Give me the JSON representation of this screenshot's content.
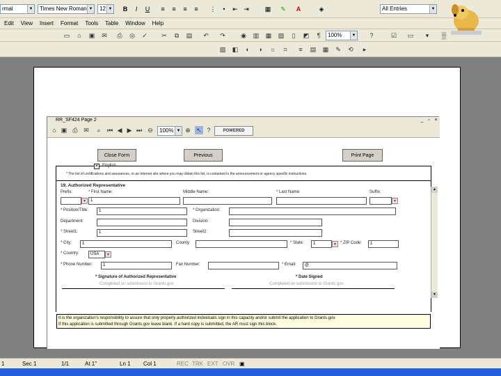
{
  "format_toolbar": {
    "style_value": "rmal",
    "font_value": "Times New Roman",
    "size_value": "12",
    "bold": "B",
    "italic": "I",
    "underline": "U",
    "view_combo": "All Entries"
  },
  "menu": {
    "items": [
      "Edit",
      "View",
      "Insert",
      "Format",
      "Tools",
      "Table",
      "Window",
      "Help"
    ]
  },
  "std_toolbar": {
    "zoom": "100%"
  },
  "form_window": {
    "title": "RR_SF424 Page 2",
    "zoom": "100%",
    "powered_label": "POWERED",
    "buttons": {
      "close_form": "Close Form",
      "previous": "Previous",
      "print_page": "Print Page"
    },
    "english_item": "English",
    "note_text": "* The list of certifications and assurances, or an Internet site where you may obtain this list, is contained in the announcement or agency specific instructions.",
    "section_title": "19. Authorized Representative",
    "labels": {
      "prefix": "Prefix:",
      "first_name": "* First Name:",
      "middle_name": "Middle Name:",
      "last_name": "* Last Name:",
      "suffix": "Suffix:",
      "position": "* Position/Title:",
      "organization": "* Organization:",
      "department": "Department:",
      "division": "Division:",
      "street1": "* Street1:",
      "street2": "Street2:",
      "city": "* City:",
      "county": "County:",
      "state": "* State:",
      "zip": "* ZIP Code:",
      "country": "* Country:",
      "phone": "* Phone Number:",
      "fax": "Fax Number:",
      "email": "* Email:"
    },
    "values": {
      "first_name": "1",
      "position": "1",
      "street1": "1",
      "city": "1",
      "state": "1",
      "zip": "1",
      "country": "USA",
      "phone": "1",
      "email": "@"
    },
    "signature": {
      "sig_title": "* Signature of Authorized Representative",
      "sig_value": "Completed on submission to Grants.gov",
      "date_title": "* Date Signed",
      "date_value": "Completed on submission to Grants.gov"
    },
    "tooltip_line1": "It is the organization's responsibility to assure that only properly authorized individuals sign in this capacity and/or submit the application to Grants.gov.",
    "tooltip_line2": "If this application is submitted through Grants.gov leave blank. If a hard copy is submitted, the AR must sign this block."
  },
  "statusbar": {
    "page": "1",
    "sec": "Sec 1",
    "pages": "1/1",
    "at": "At 1\"",
    "ln": "Ln 1",
    "col": "Col 1",
    "rec": "REC",
    "trk": "TRK",
    "ext": "EXT",
    "ovr": "OVR"
  },
  "colors": {
    "chrome": "#ece9d8",
    "doc_bg": "#808080",
    "tooltip_bg": "#ffffe1",
    "required_arrow": "#cc0000"
  }
}
